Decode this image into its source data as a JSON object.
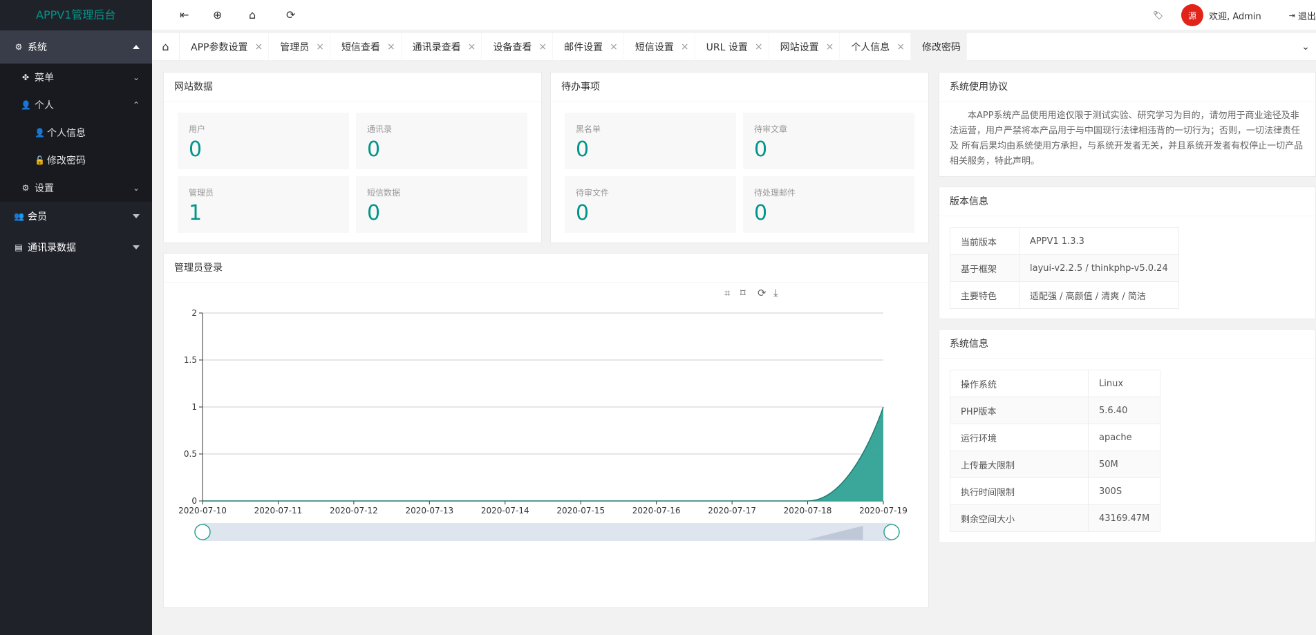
{
  "app": {
    "title": "APPV1管理后台"
  },
  "sidebar": {
    "system": {
      "label": "系统"
    },
    "menu": {
      "label": "菜单"
    },
    "personal": {
      "label": "个人"
    },
    "personal_info": {
      "label": "个人信息"
    },
    "change_password": {
      "label": "修改密码"
    },
    "settings": {
      "label": "设置"
    },
    "members": {
      "label": "会员"
    },
    "contacts_data": {
      "label": "通讯录数据"
    }
  },
  "header": {
    "welcome": "欢迎, Admin",
    "logout": "退出",
    "avatar_text": "源"
  },
  "tabs": [
    {
      "label": "APP参数设置"
    },
    {
      "label": "管理员"
    },
    {
      "label": "短信查看"
    },
    {
      "label": "通讯录查看"
    },
    {
      "label": "设备查看"
    },
    {
      "label": "邮件设置"
    },
    {
      "label": "短信设置"
    },
    {
      "label": "URL 设置"
    },
    {
      "label": "网站设置"
    },
    {
      "label": "个人信息"
    },
    {
      "label": "修改密码"
    }
  ],
  "site_data": {
    "title": "网站数据",
    "stats": [
      {
        "label": "用户",
        "value": "0"
      },
      {
        "label": "通讯录",
        "value": "0"
      },
      {
        "label": "管理员",
        "value": "1"
      },
      {
        "label": "短信数据",
        "value": "0"
      }
    ]
  },
  "todo": {
    "title": "待办事项",
    "stats": [
      {
        "label": "黑名单",
        "value": "0"
      },
      {
        "label": "待审文章",
        "value": "0"
      },
      {
        "label": "待审文件",
        "value": "0"
      },
      {
        "label": "待处理邮件",
        "value": "0"
      }
    ]
  },
  "agreement": {
    "title": "系统使用协议",
    "text": "本APP系统产品使用用途仅限于测试实验、研究学习为目的，请勿用于商业途径及非法运营，用户严禁将本产品用于与中国现行法律相违背的一切行为；否则，一切法律责任 及 所有后果均由系统使用方承担，与系统开发者无关，并且系统开发者有权停止一切产品相关服务，特此声明。"
  },
  "version_info": {
    "title": "版本信息",
    "rows": [
      {
        "key": "当前版本",
        "value": "APPV1 1.3.3"
      },
      {
        "key": "基于框架",
        "value": "layui-v2.2.5 / thinkphp-v5.0.24"
      },
      {
        "key": "主要特色",
        "value": "适配强 / 高颜值 / 清爽 / 简洁"
      }
    ]
  },
  "system_info": {
    "title": "系统信息",
    "rows": [
      {
        "key": "操作系统",
        "value": "Linux"
      },
      {
        "key": "PHP版本",
        "value": "5.6.40"
      },
      {
        "key": "运行环境",
        "value": "apache"
      },
      {
        "key": "上传最大限制",
        "value": "50M"
      },
      {
        "key": "执行时间限制",
        "value": "300S"
      },
      {
        "key": "剩余空间大小",
        "value": "43169.47M"
      }
    ]
  },
  "admin_login": {
    "title": "管理员登录"
  },
  "colors": {
    "accent": "#009688",
    "sidebar": "#20222a",
    "series": "#2fa295"
  },
  "chart_data": {
    "type": "area",
    "title": "",
    "xlabel": "",
    "ylabel": "",
    "x": [
      "2020-07-10",
      "2020-07-11",
      "2020-07-12",
      "2020-07-13",
      "2020-07-14",
      "2020-07-15",
      "2020-07-16",
      "2020-07-17",
      "2020-07-18",
      "2020-07-19"
    ],
    "series": [
      {
        "values": [
          0,
          0,
          0,
          0,
          0,
          0,
          0,
          0,
          0,
          1
        ]
      }
    ],
    "ylim": [
      0,
      2
    ],
    "yticks": [
      "0",
      "0.5",
      "1",
      "1.5",
      "2"
    ],
    "grid": true,
    "smooth": true,
    "toolbox": [
      "zoom-icon",
      "zoom-reset-icon",
      "restore-icon",
      "download-icon"
    ]
  }
}
